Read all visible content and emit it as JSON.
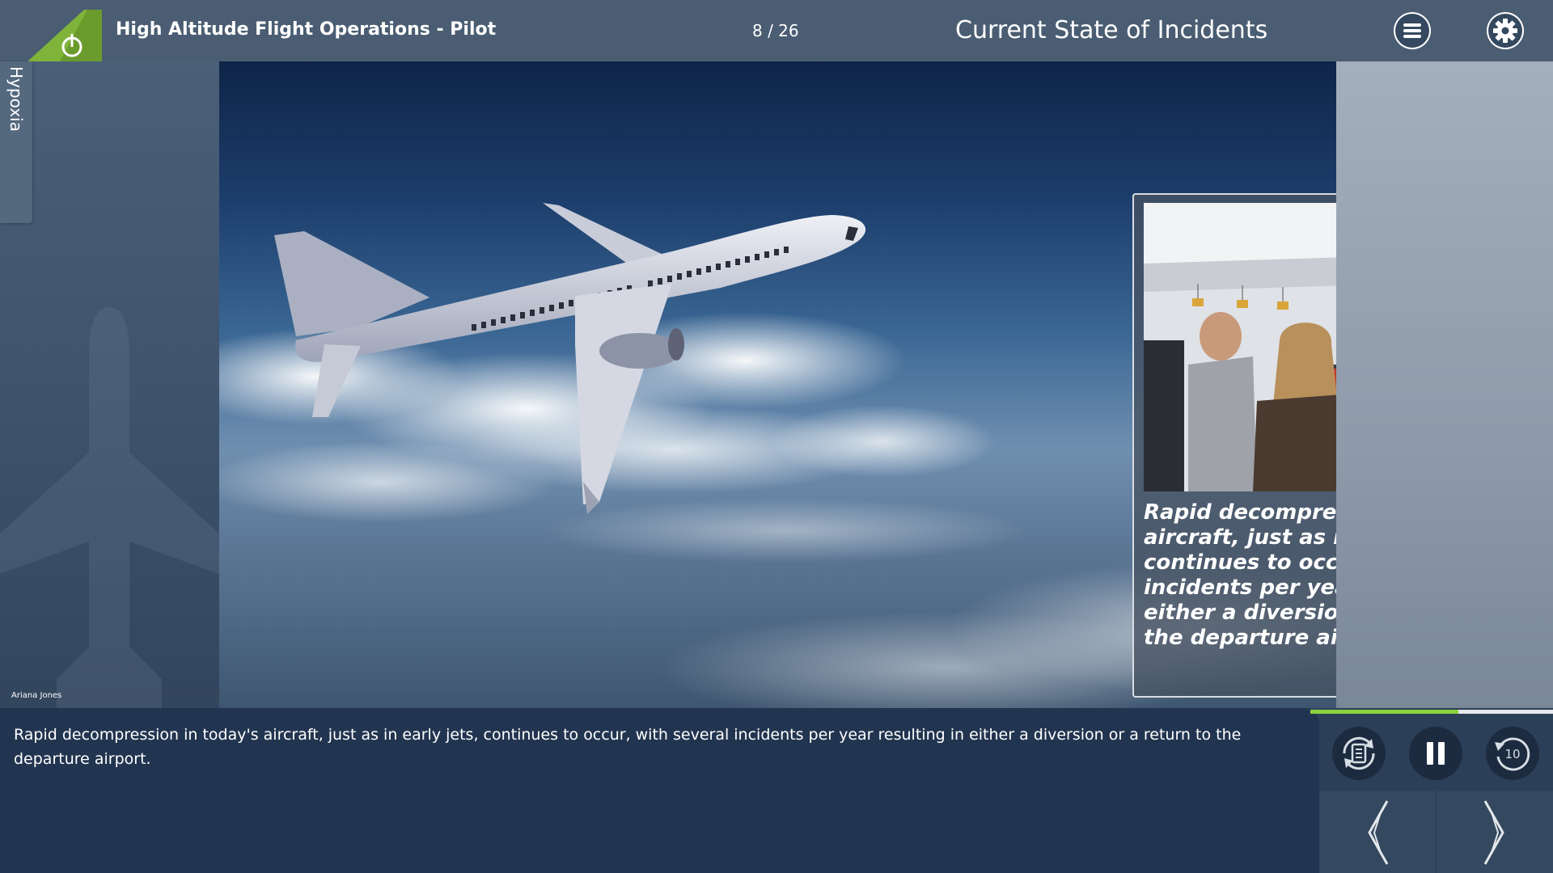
{
  "header": {
    "course_title": "High Altitude Flight Operations - Pilot",
    "page_counter": "8 / 26",
    "slide_title": "Current State of Incidents",
    "menu_icon": "menu-icon",
    "settings_icon": "gear-icon"
  },
  "sidebar": {
    "tab_label": "Hypoxia"
  },
  "narrator": {
    "name": "Ariana Jones"
  },
  "slide": {
    "card_text": "Rapid decompression in today's aircraft, just as in early jets, continues to occur, with several incidents per year resulting in either a diversion or a return to the departure airport."
  },
  "transcript": {
    "text": "Rapid decompression in today's aircraft, just as in early jets, continues to occur, with several incidents per year resulting in either a diversion or a return to the departure airport."
  },
  "controls": {
    "progress_fraction": 0.61,
    "replay_seconds": "10",
    "transcript_icon": "transcript-refresh-icon",
    "pause_icon": "pause-icon",
    "replay_icon": "replay-10-icon",
    "prev_icon": "chevron-left-icon",
    "next_icon": "chevron-right-icon"
  },
  "colors": {
    "header_bg": "#4a5d72",
    "transcript_bg": "#223550",
    "progress": "#8bd23c",
    "logo_green": "#7fb33a"
  }
}
